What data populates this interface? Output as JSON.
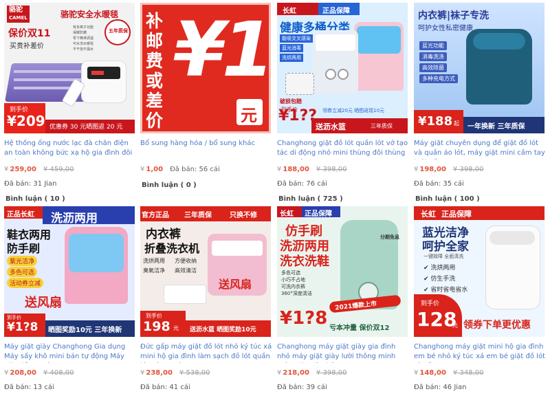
{
  "products": [
    {
      "title": "Hệ thống ống nước lạc đà chăn điện an toàn không bức xạ hộ gia đình đôi nước",
      "currency": "¥",
      "price": "259,00",
      "old_price": "459,00",
      "sold": "Đã bán: 31 Jian",
      "image": {
        "brand": "骆驼",
        "brand_sub": "CAMEL",
        "headline": "骆驼安全水暖毯",
        "promo_line1": "保价双11",
        "promo_line2": "买贵补差价",
        "badge": "五年质保",
        "price_label": "到手价",
        "price": "¥209",
        "bottom": "优惠券 30 元晒图返 20 元",
        "feature_lines": [
          "有负离子功能",
          "保暖防螨",
          "零下精准调温",
          "可水洗水暖毯",
          "不干烧不漏水"
        ]
      }
    },
    {
      "title": "Bổ sung hàng hóa / bổ sung khác",
      "currency": "¥",
      "price": "1,00",
      "sold_inline": "Đã bán: 56 cái",
      "image": {
        "left_text": "补邮费或差价",
        "big": "¥1",
        "unit": "元"
      }
    },
    {
      "title": "Changhong giặt đồ lót quần lót vớ tạo tác di động nhỏ mini thùng đôi thùng phụ máy",
      "currency": "¥",
      "price": "188,00",
      "old_price": "398,00",
      "sold": "Đã bán: 76 cái",
      "image": {
        "brand": "长虹",
        "tag": "正品保障",
        "headline": "健康多桶分类",
        "features": [
          "能吸交叉感染",
          "蓝光消毒",
          "洗烘两用"
        ],
        "promo": "破损包赔",
        "price_label": "到手价",
        "price": "¥1??",
        "coupon": "领券立减20元 晒图返现10元",
        "bottom": "送沥水篮",
        "bottom_tag": "三年质保"
      }
    },
    {
      "title": "Máy giặt chuyên dụng để giặt đồ lót và quần áo lót, máy giặt mini cầm tay lưới gấp",
      "currency": "¥",
      "price": "198,00",
      "old_price": "398,00",
      "sold": "Đã bán: 35 cái",
      "image": {
        "headline": "内衣裤|袜子专洗",
        "sub": "呵护女性私密健康",
        "features": [
          "蓝光功能",
          "消毒洗涤",
          "高效除菌",
          "多种充电方式"
        ],
        "price": "¥188",
        "price_suffix": "起",
        "bottom": "一年换新  三年质保"
      }
    },
    {
      "title": "Máy giặt giày Changhong Gia dụng Máy sấy khô mini bán tự động Máy giặt đồ tạo tác",
      "currency": "¥",
      "price": "208,00",
      "old_price": "408,00",
      "sold": "Đã bán: 13 cái",
      "image": {
        "tag": "正品长虹",
        "headline": "洗沥两用",
        "sub": "鞋衣两用",
        "sub2": "防手刷",
        "features": [
          "紫光洁净",
          "多色可选",
          "活动券立减"
        ],
        "gift": "送风扇",
        "price_label": "到手价",
        "price": "¥1?8",
        "bottom": "晒图奖励10元 三年换新"
      }
    },
    {
      "title": "Đức gấp máy giặt đồ lót nhỏ ký túc xá mini hộ gia đình làm sạch đồ lót quần lót vớ tạo tác",
      "currency": "¥",
      "price": "238,00",
      "old_price": "538,00",
      "sold": "Đã bán: 41 cái",
      "image": {
        "tag": "官方正品",
        "tag2": "三年质保",
        "tag3": "只换不修",
        "headline1": "内衣裤",
        "headline2": "折叠洗衣机",
        "features": [
          "洗烘两用",
          "方便收纳",
          "臭氧洁净",
          "高效清洁"
        ],
        "gift": "送风扇",
        "price_label": "到手价",
        "price": "198",
        "price_suffix": "元",
        "bottom": "送沥水篮  晒图奖励10元"
      }
    },
    {
      "title": "Changhong máy giặt giày gia đình nhỏ máy giặt giày lười thông minh máy giặt giày kỷ",
      "currency": "¥",
      "price": "218,00",
      "old_price": "398,00",
      "sold": "Đã bán: 39 cái",
      "image": {
        "brand": "长虹",
        "tag": "正品保障",
        "headline1": "仿手刷",
        "headline2": "洗沥两用",
        "headline3": "洗衣洗鞋",
        "features": [
          "多色可选",
          "小巧不占地",
          "可洗内衣裤",
          "360°深度清洁"
        ],
        "badge": "分期免息",
        "new": "2021爆款上市",
        "price": "¥1?8",
        "bottom": "亏本冲量  保价双12"
      }
    },
    {
      "title": "Changhong máy giặt mini hộ gia đình em bé nhỏ ký túc xá em bé giặt đồ lót và tất",
      "currency": "¥",
      "price": "148,00",
      "old_price": "348,00",
      "sold": "Đã bán: 46 Jian",
      "image": {
        "brand": "长虹",
        "tag": "正品保障",
        "headline1": "蓝光洁净",
        "headline2": "呵护全家",
        "sub": "一键故障 全面清洗",
        "features": [
          "洗烘两用",
          "仿生手洗",
          "省时省电省水"
        ],
        "price_label": "到手价",
        "price": "128",
        "price_suffix": "元",
        "bottom": "领券下单更优惠"
      }
    }
  ],
  "reviews": [
    "Bình luận ( 10 )",
    "Bình luận ( 0 )",
    "Bình luận ( 725 )",
    "Bình luận ( 100 )"
  ],
  "colors": {
    "title_link": "#4c78c8",
    "price": "#e0553b",
    "muted": "#9e9e9e",
    "badge_red": "#d9231b"
  }
}
